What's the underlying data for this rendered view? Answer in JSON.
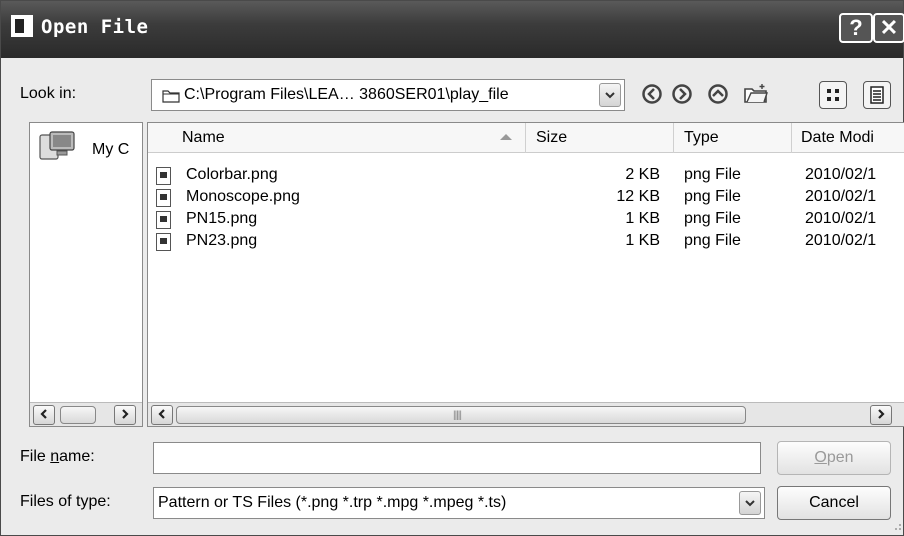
{
  "window": {
    "title": "Open File",
    "help_glyph": "?",
    "close_glyph": "✕"
  },
  "look_in": {
    "label": "Look in:",
    "path": "C:\\Program Files\\LEA… 3860SER01\\play_file",
    "icons": [
      "back-icon",
      "forward-icon",
      "up-folder-icon",
      "new-folder-icon",
      "list-view-icon",
      "details-view-icon"
    ]
  },
  "places": {
    "items": [
      {
        "label": "My C",
        "icon": "my-computer-icon"
      }
    ]
  },
  "file_list": {
    "columns": [
      "Name",
      "Size",
      "Type",
      "Date Modi"
    ],
    "rows": [
      {
        "name": "Colorbar.png",
        "size": "2 KB",
        "type": "png File",
        "date": "2010/02/1"
      },
      {
        "name": "Monoscope.png",
        "size": "12 KB",
        "type": "png File",
        "date": "2010/02/1"
      },
      {
        "name": "PN15.png",
        "size": "1 KB",
        "type": "png File",
        "date": "2010/02/1"
      },
      {
        "name": "PN23.png",
        "size": "1 KB",
        "type": "png File",
        "date": "2010/02/1"
      }
    ]
  },
  "file_name": {
    "label_pre": "File ",
    "label_accel": "n",
    "label_post": "ame:",
    "value": ""
  },
  "file_type": {
    "label": "Files of type:",
    "selected": "Pattern or TS Files (*.png *.trp *.mpg *.mpeg *.ts)"
  },
  "buttons": {
    "open_accel": "O",
    "open_rest": "pen",
    "cancel": "Cancel"
  },
  "colors": {
    "title_bar": "#3c3c3c",
    "dialog_bg": "#ebebeb",
    "disabled_text": "#9a9a9a"
  }
}
